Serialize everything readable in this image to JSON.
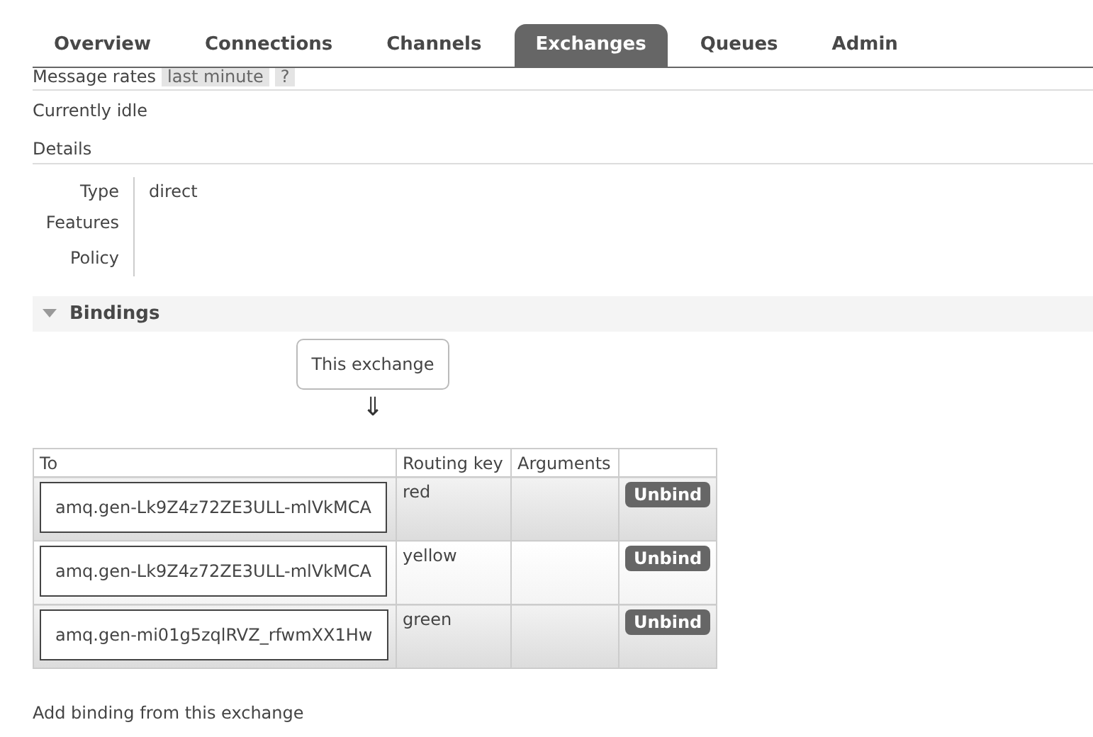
{
  "tabs": [
    {
      "label": "Overview",
      "selected": false
    },
    {
      "label": "Connections",
      "selected": false
    },
    {
      "label": "Channels",
      "selected": false
    },
    {
      "label": "Exchanges",
      "selected": true
    },
    {
      "label": "Queues",
      "selected": false
    },
    {
      "label": "Admin",
      "selected": false
    }
  ],
  "message_rates": {
    "label": "Message rates",
    "period": "last minute",
    "help": "?"
  },
  "status": "Currently idle",
  "details": {
    "heading": "Details",
    "fields": [
      {
        "label": "Type",
        "value": "direct"
      },
      {
        "label": "Features"
      },
      {
        "label": "Policy"
      }
    ]
  },
  "bindings": {
    "heading": "Bindings",
    "expanded": true,
    "source": "This exchange",
    "arrow": "⇓",
    "columns": [
      "To",
      "Routing key",
      "Arguments"
    ],
    "rows": [
      {
        "to": "amq.gen-Lk9Z4z72ZE3ULL-mlVkMCA",
        "routing_key": "red",
        "action": "Unbind"
      },
      {
        "to": "amq.gen-Lk9Z4z72ZE3ULL-mlVkMCA",
        "routing_key": "yellow",
        "action": "Unbind"
      },
      {
        "to": "amq.gen-mi01g5zqlRVZ_rfwmXX1Hw",
        "routing_key": "green",
        "action": "Unbind"
      }
    ]
  },
  "add_binding": "Add binding from this exchange"
}
